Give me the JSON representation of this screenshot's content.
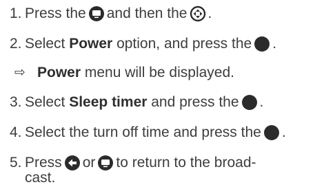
{
  "steps": [
    {
      "number": "1.",
      "t1": "Press the",
      "icon1": "settings-button-icon",
      "t2": "and then the",
      "icon2": "home-button-icon",
      "t3": "."
    },
    {
      "number": "2.",
      "t1": "Select ",
      "bold1": "Power",
      "t2": " option, and press the",
      "icon1": "ok-button-icon",
      "t3": "."
    },
    {
      "result_symbol": "⇨",
      "bold1": "Power",
      "t1": " menu will be displayed."
    },
    {
      "number": "3.",
      "t1": "Select ",
      "bold1": "Sleep timer",
      "t2": " and press the",
      "icon1": "ok-button-icon",
      "t3": "."
    },
    {
      "number": "4.",
      "t1": "Select the turn off time and press the",
      "icon1": "ok-button-icon",
      "t2": "."
    },
    {
      "number": "5.",
      "t1": "Press",
      "icon1": "back-button-icon",
      "t2": "or",
      "icon2": "settings-button-icon",
      "t3": "to return to the broad-",
      "t4": "cast."
    }
  ],
  "colors": {
    "text": "#3d3d3d",
    "icon": "#2b2b2b"
  }
}
